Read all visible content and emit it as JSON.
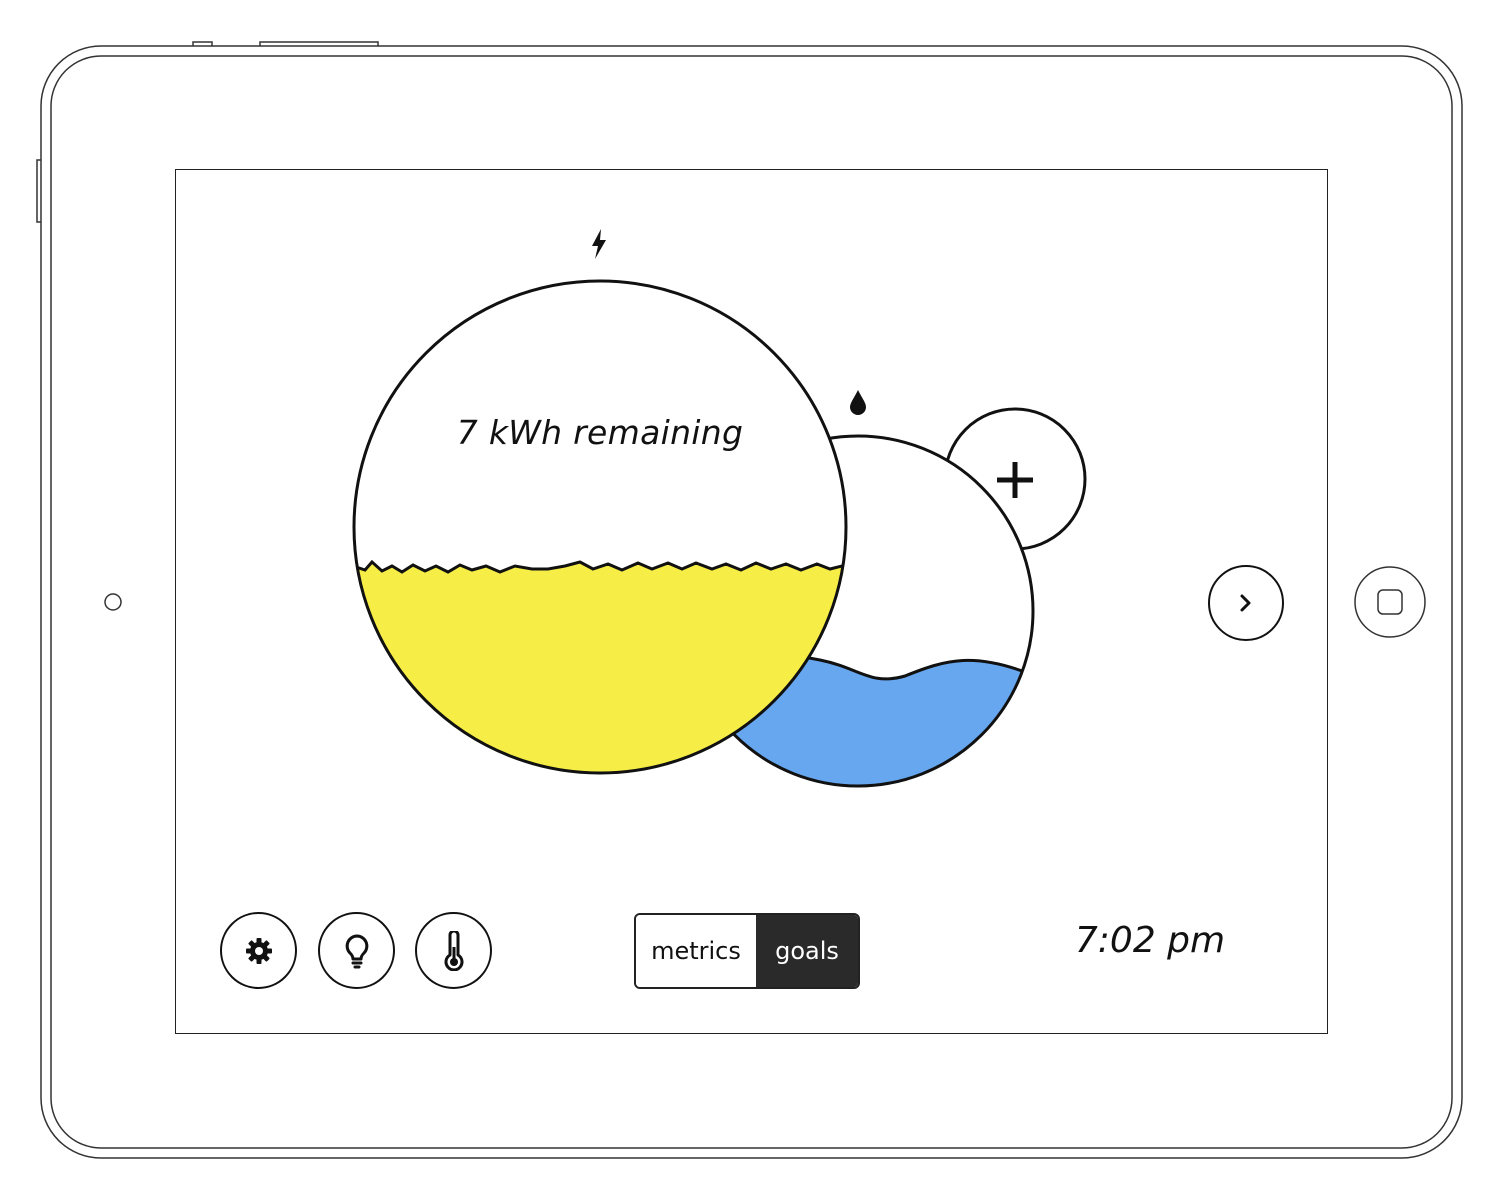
{
  "energy_gauge": {
    "icon": "lightning-icon",
    "label": "7 kWh remaining",
    "fill_fraction": 0.43,
    "fill_color": "#F6EE47"
  },
  "water_gauge": {
    "icon": "water-drop-icon",
    "fill_fraction": 0.35,
    "fill_color": "#67A7EF"
  },
  "add_button": {
    "icon": "plus-icon"
  },
  "navigation": {
    "next_icon": "chevron-right-icon"
  },
  "toolbar": {
    "buttons": [
      {
        "icon": "gear-icon"
      },
      {
        "icon": "lightbulb-icon"
      },
      {
        "icon": "thermometer-icon"
      }
    ]
  },
  "view_toggle": {
    "options": [
      "metrics",
      "goals"
    ],
    "selected": "goals"
  },
  "clock": {
    "time": "7:02 pm"
  },
  "colors": {
    "energy": "#F6EE47",
    "water": "#67A7EF",
    "outline": "#111111",
    "selected_segment": "#2A2A2A"
  }
}
